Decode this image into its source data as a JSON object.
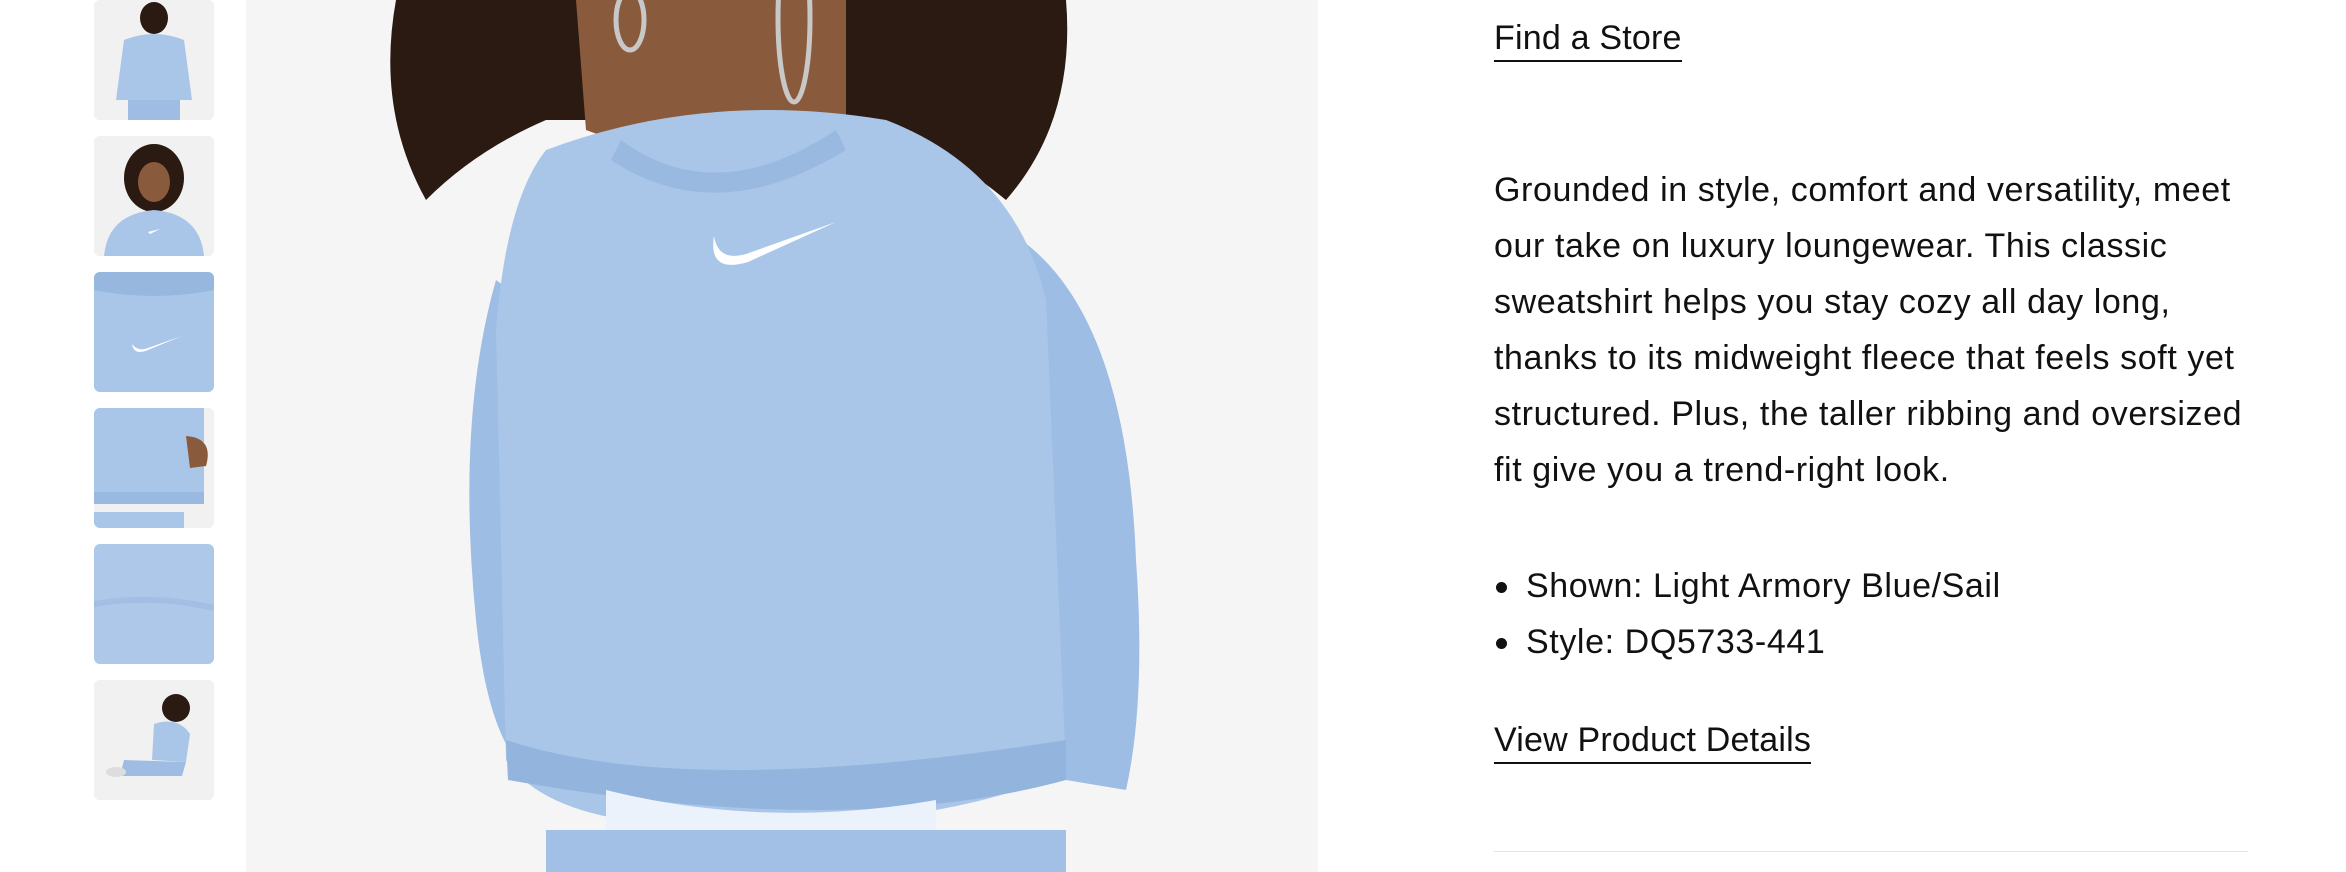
{
  "gallery": {
    "thumbnails": [
      {
        "alt": "back view"
      },
      {
        "alt": "front portrait"
      },
      {
        "alt": "logo detail"
      },
      {
        "alt": "side hem detail"
      },
      {
        "alt": "fabric texture"
      },
      {
        "alt": "seated full outfit"
      }
    ]
  },
  "product": {
    "find_store_label": "Find a Store",
    "description": "Grounded in style, comfort and versatility, meet our take on luxury loungewear. This classic sweatshirt helps you stay cozy all day long, thanks to its midweight fleece that feels soft yet structured. Plus, the taller ribbing and oversized fit give you a trend-right look.",
    "bullets": {
      "shown": "Shown: Light Armory Blue/Sail",
      "style": "Style: DQ5733-441"
    },
    "view_details_label": "View Product Details"
  },
  "colors": {
    "sweatshirt": "#a9c6e8",
    "sweatshirt_shadow": "#8fb0d8",
    "background": "#f5f5f5",
    "skin": "#8a5a3c",
    "hair": "#2a1a12",
    "text": "#111111"
  }
}
